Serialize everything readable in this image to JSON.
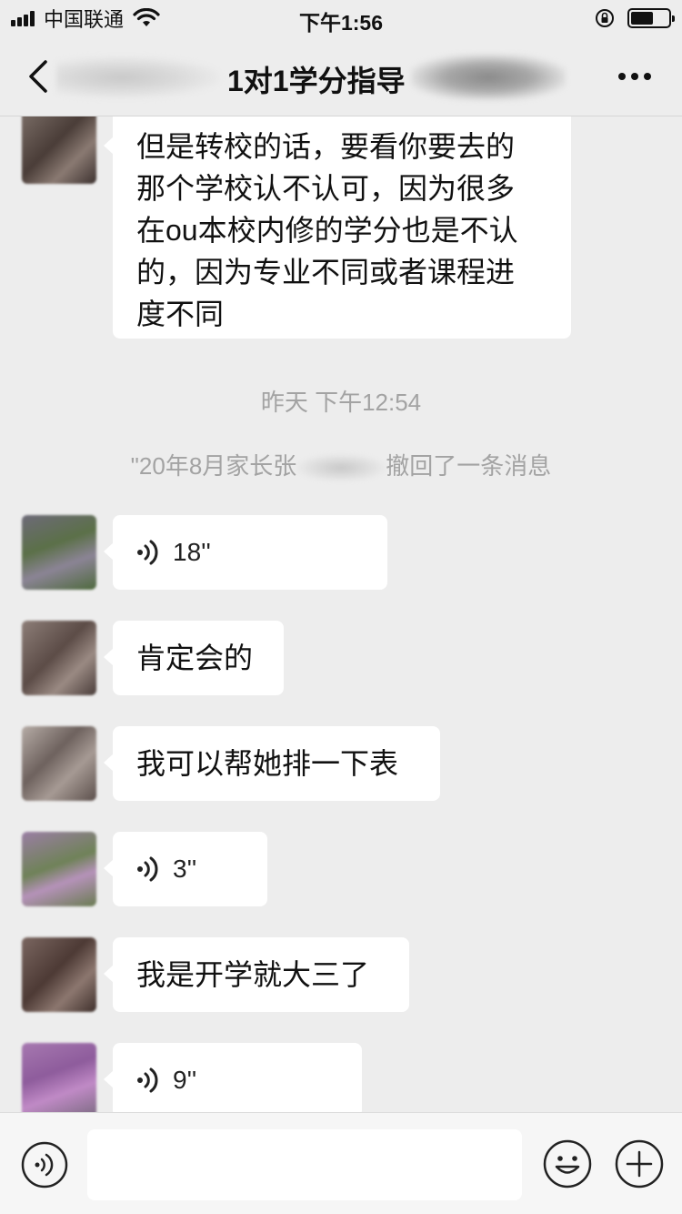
{
  "status_bar": {
    "carrier": "中国联通",
    "time": "下午1:56",
    "icons": [
      "signal-icon",
      "wifi-icon",
      "rotation-lock-icon",
      "battery-icon"
    ]
  },
  "nav": {
    "title": "1对1学分指导",
    "back_icon": "chevron-left-icon",
    "more_icon": "more-dots-icon"
  },
  "messages_top": {
    "text": "但是转校的话，要看你要去的那个学校认不认可，因为很多在ou本校内修的学分也是不认的，因为专业不同或者课程进度不同",
    "lines": [
      "但是转校的话，要看你要去的",
      "那个学校认不认可，因为很多",
      "在ou本校内修的学分也是不认",
      "的，因为专业不同或者课程进",
      "度不同"
    ]
  },
  "divider": {
    "time": "昨天 下午12:54"
  },
  "system": {
    "prefix": "\"20年8月家长张",
    "suffix": "撤回了一条消息"
  },
  "messages": [
    {
      "type": "voice",
      "duration": "18''"
    },
    {
      "type": "text",
      "text": "肯定会的"
    },
    {
      "type": "text",
      "text": "我可以帮她排一下表"
    },
    {
      "type": "voice",
      "duration": "3''"
    },
    {
      "type": "text",
      "text": "我是开学就大三了"
    },
    {
      "type": "voice",
      "duration": "9''"
    }
  ],
  "input_bar": {
    "placeholder": "",
    "icons": [
      "voice-toggle-icon",
      "emoji-icon",
      "plus-icon"
    ]
  },
  "colors": {
    "background": "#ededed",
    "bubble": "#ffffff",
    "hint_text": "#a3a3a3"
  }
}
